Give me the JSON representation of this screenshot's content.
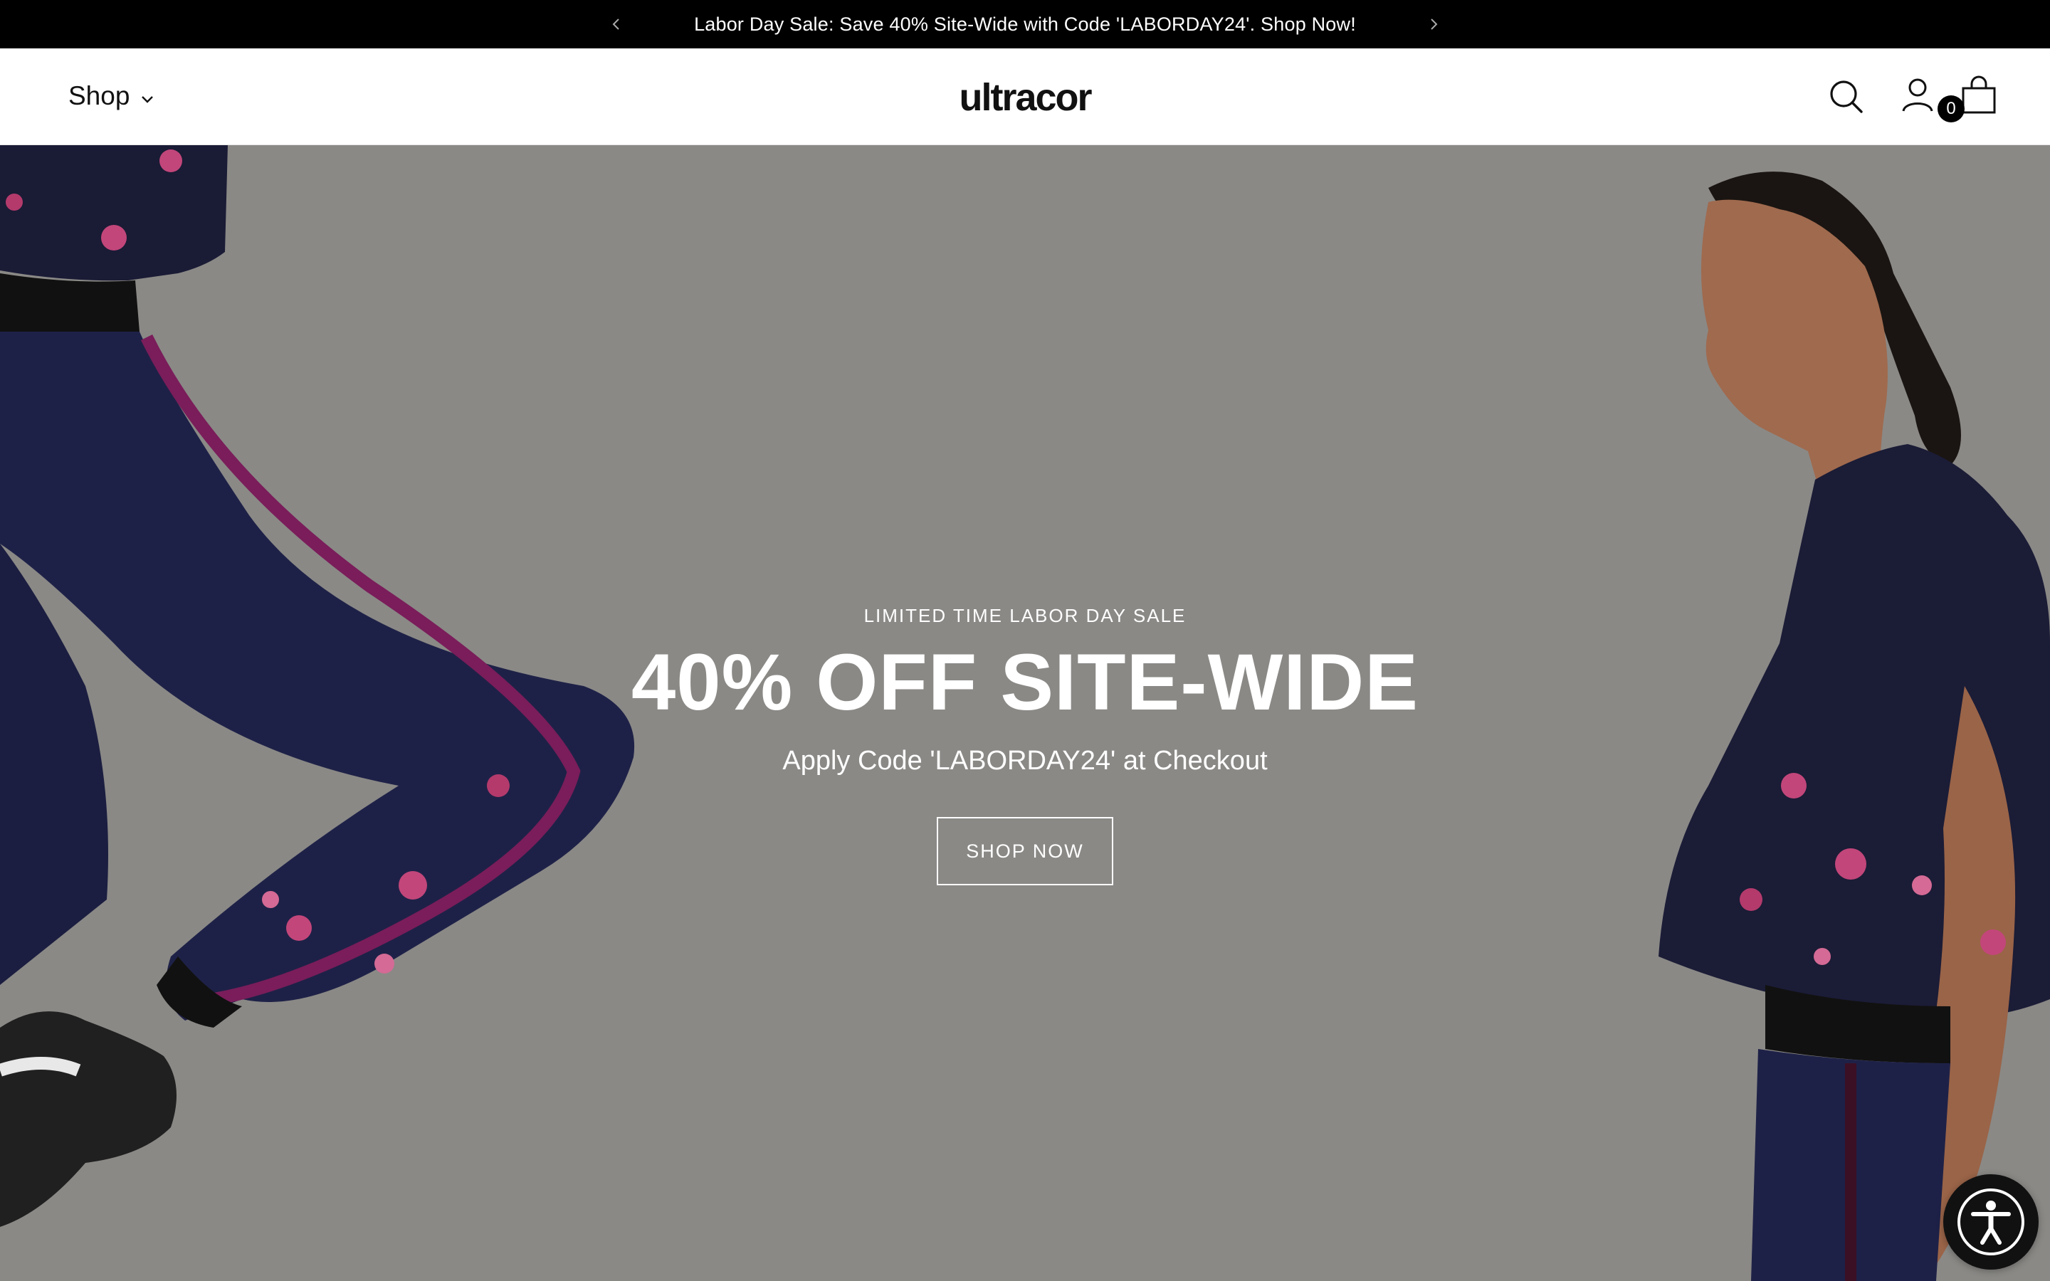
{
  "announcement": {
    "text": "Labor Day Sale: Save 40% Site-Wide with Code 'LABORDAY24'. Shop Now!",
    "prev_icon": "chevron-left-icon",
    "next_icon": "chevron-right-icon"
  },
  "header": {
    "shop_label": "Shop",
    "logo_text": "ultracor",
    "cart_count": "0",
    "icons": [
      "search-icon",
      "account-icon",
      "cart-bag-icon"
    ]
  },
  "hero": {
    "eyebrow": "LIMITED TIME LABOR DAY SALE",
    "title": "40% OFF SITE-WIDE",
    "subtitle": "Apply Code 'LABORDAY24' at Checkout",
    "cta_label": "SHOP NOW"
  },
  "accessibility": {
    "icon": "accessibility-icon"
  },
  "colors": {
    "announcement_bg": "#000000",
    "header_bg": "#ffffff",
    "hero_bg": "#8a8986",
    "legging_navy": "#1e2147",
    "floral_pink": "#c2467a"
  }
}
